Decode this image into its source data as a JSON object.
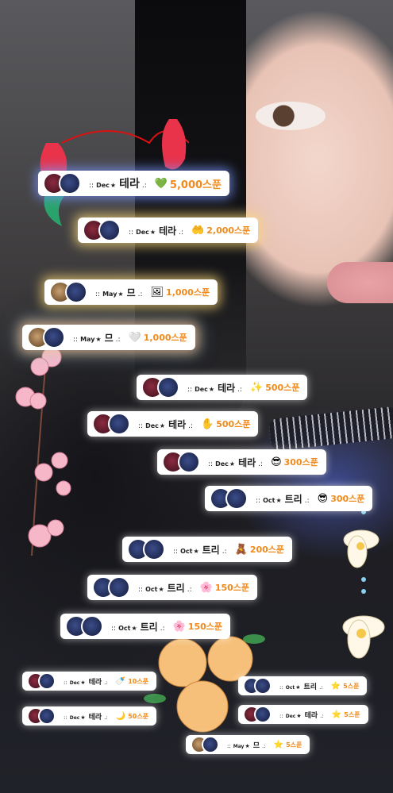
{
  "donations": [
    {
      "dots": "::",
      "month": "Dec",
      "star": "★",
      "name": "테라",
      "tail": ".:",
      "gift_icon": "heart-gem-icon",
      "amount": "5,000스푼",
      "avatars": [
        "wine",
        "navy"
      ]
    },
    {
      "dots": "::",
      "month": "Dec",
      "star": "★",
      "name": "테라",
      "tail": ".:",
      "gift_icon": "hands-icon",
      "amount": "2,000스푼",
      "avatars": [
        "wine",
        "navy"
      ]
    },
    {
      "dots": "::",
      "month": "May",
      "star": "★",
      "name": "므",
      "tail": ".:",
      "gift_icon": "frame-icon",
      "amount": "1,000스푼",
      "avatars": [
        "food",
        "navy"
      ]
    },
    {
      "dots": "::",
      "month": "May",
      "star": "★",
      "name": "므",
      "tail": ".:",
      "gift_icon": "heart-frame-icon",
      "amount": "1,000스푼",
      "avatars": [
        "food",
        "navy"
      ]
    },
    {
      "dots": "::",
      "month": "Dec",
      "star": "★",
      "name": "테라",
      "tail": ".:",
      "gift_icon": "sparkle-icon",
      "amount": "500스푼",
      "avatars": [
        "wine",
        "navy"
      ]
    },
    {
      "dots": "::",
      "month": "Dec",
      "star": "★",
      "name": "테라",
      "tail": ".:",
      "gift_icon": "hand-icon",
      "amount": "500스푼",
      "avatars": [
        "wine",
        "navy"
      ]
    },
    {
      "dots": "::",
      "month": "Dec",
      "star": "★",
      "name": "테라",
      "tail": ".:",
      "gift_icon": "sunglasses-icon",
      "amount": "300스푼",
      "avatars": [
        "wine",
        "navy"
      ]
    },
    {
      "dots": "::",
      "month": "Oct",
      "star": "★",
      "name": "트리",
      "tail": ".:",
      "gift_icon": "sunglasses-icon",
      "amount": "300스푼",
      "avatars": [
        "navy",
        "navy"
      ]
    },
    {
      "dots": "::",
      "month": "Oct",
      "star": "★",
      "name": "트리",
      "tail": ".:",
      "gift_icon": "character-icon",
      "amount": "200스푼",
      "avatars": [
        "navy",
        "navy"
      ]
    },
    {
      "dots": "::",
      "month": "Oct",
      "star": "★",
      "name": "트리",
      "tail": ".:",
      "gift_icon": "flower-icon",
      "amount": "150스푼",
      "avatars": [
        "navy",
        "navy"
      ]
    },
    {
      "dots": "::",
      "month": "Oct",
      "star": "★",
      "name": "트리",
      "tail": ".:",
      "gift_icon": "flower-icon",
      "amount": "150스푼",
      "avatars": [
        "navy",
        "navy"
      ]
    },
    {
      "dots": "::",
      "month": "Dec",
      "star": "★",
      "name": "테라",
      "tail": ".:",
      "gift_icon": "bottle-icon",
      "amount": "10스푼",
      "avatars": [
        "wine",
        "navy"
      ]
    },
    {
      "dots": "::",
      "month": "Oct",
      "star": "★",
      "name": "트리",
      "tail": ".:",
      "gift_icon": "star-icon",
      "amount": "5스푼",
      "avatars": [
        "navy",
        "navy"
      ]
    },
    {
      "dots": "::",
      "month": "Dec",
      "star": "★",
      "name": "테라",
      "tail": ".:",
      "gift_icon": "moon-icon",
      "amount": "50스푼",
      "avatars": [
        "wine",
        "navy"
      ]
    },
    {
      "dots": "::",
      "month": "Dec",
      "star": "★",
      "name": "테라",
      "tail": ".:",
      "gift_icon": "star-icon",
      "amount": "5스푼",
      "avatars": [
        "wine",
        "navy"
      ]
    },
    {
      "dots": "::",
      "month": "May",
      "star": "★",
      "name": "므",
      "tail": ".:",
      "gift_icon": "star-icon",
      "amount": "5스푼",
      "avatars": [
        "food",
        "navy"
      ]
    }
  ],
  "gift_glyphs": {
    "heart-gem-icon": "💚",
    "hands-icon": "🤲",
    "frame-icon": "🖼",
    "heart-frame-icon": "🤍",
    "sparkle-icon": "✨",
    "hand-icon": "✋",
    "sunglasses-icon": "😎",
    "character-icon": "🧸",
    "flower-icon": "🌸",
    "bottle-icon": "🍼",
    "star-icon": "⭐",
    "moon-icon": "🌙"
  },
  "colors": {
    "amount": "#f08a1c",
    "badge_bg": "#ffffff"
  }
}
